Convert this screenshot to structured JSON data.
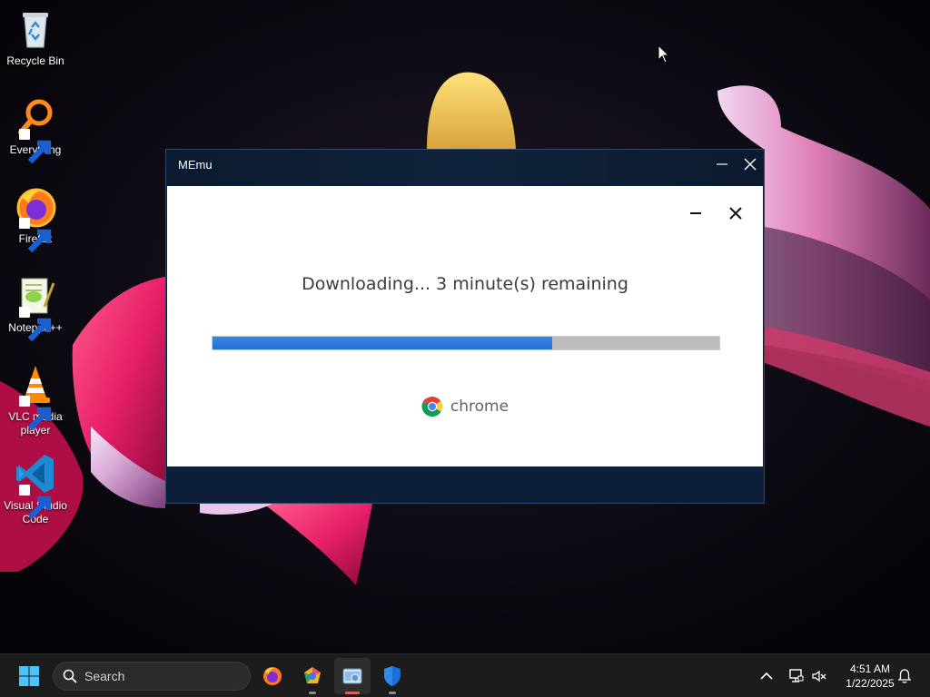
{
  "desktop": {
    "icons": [
      {
        "label": "Recycle Bin",
        "icon": "recycle-bin-icon"
      },
      {
        "label": "Everything",
        "icon": "everything-search-icon"
      },
      {
        "label": "Firefox",
        "icon": "firefox-icon"
      },
      {
        "label": "Notepad++",
        "icon": "notepad-plus-plus-icon"
      },
      {
        "label": "VLC media player",
        "icon": "vlc-icon"
      },
      {
        "label": "Visual Studio Code",
        "icon": "vscode-icon"
      }
    ]
  },
  "memu_window": {
    "title": "MEmu",
    "installer": {
      "status": "Downloading... 3 minute(s) remaining",
      "progress_percent": 67,
      "brand": "chrome"
    }
  },
  "taskbar": {
    "search_label": "Search",
    "apps": [
      {
        "name": "Firefox",
        "icon": "firefox-icon"
      },
      {
        "name": "Chrome Installer",
        "icon": "chrome-installer-icon"
      },
      {
        "name": "MEmu",
        "icon": "memu-icon",
        "active": true
      },
      {
        "name": "Windows Security",
        "icon": "windows-security-icon"
      }
    ],
    "clock": {
      "time": "4:51 AM",
      "date": "1/22/2025"
    }
  },
  "colors": {
    "progress": "#2a7be4",
    "memu_frame": "#0d1d33",
    "taskbar": "#1c1c1c"
  }
}
